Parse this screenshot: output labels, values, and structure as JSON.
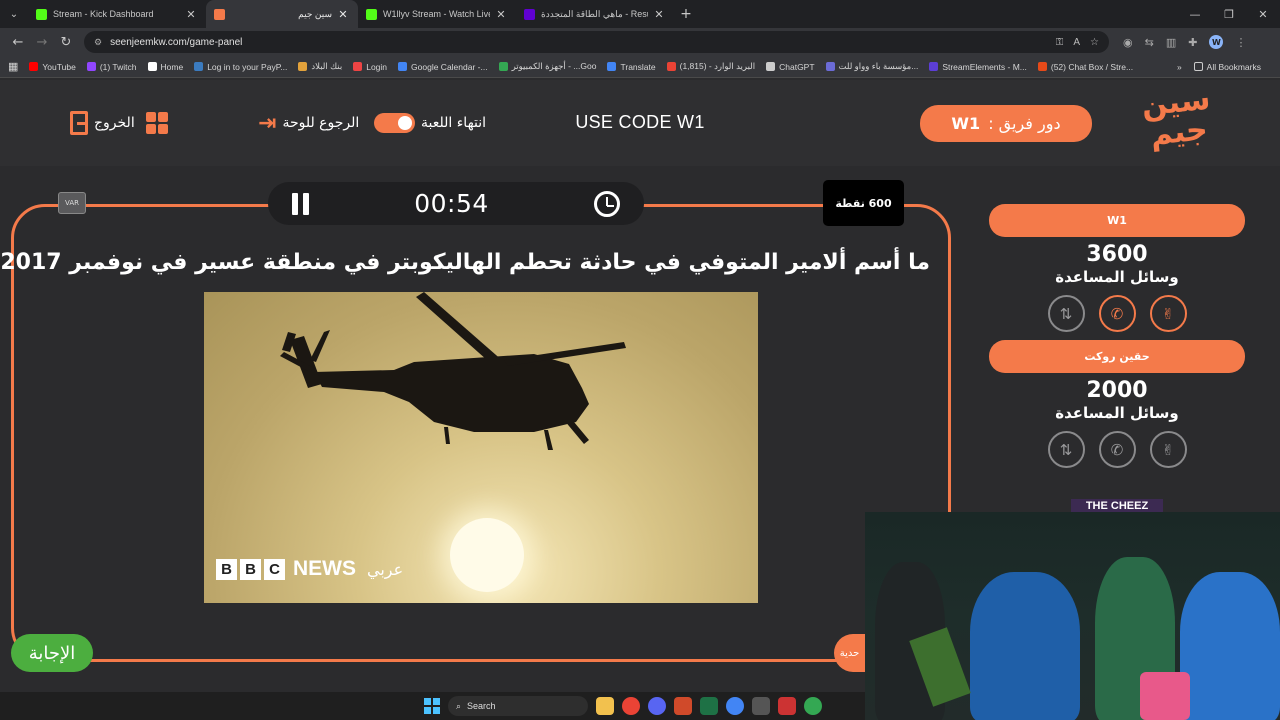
{
  "browser": {
    "tabs": [
      {
        "title": "Stream - Kick Dashboard",
        "color": "#53fc18",
        "active": false
      },
      {
        "title": "سين جيم",
        "color": "#f47a4a",
        "active": true
      },
      {
        "title": "W1llyv Stream - Watch Live on",
        "color": "#53fc18",
        "active": false
      },
      {
        "title": "ماهي الطاقة المتجددة - Results",
        "color": "#6001d2",
        "active": false
      }
    ],
    "url": "seenjeemkw.com/game-panel",
    "bookmarks": [
      {
        "label": "YouTube",
        "color": "#ff0000"
      },
      {
        "label": "(1) Twitch",
        "color": "#9146ff"
      },
      {
        "label": "Home",
        "color": "#ffffff"
      },
      {
        "label": "Log in to your PayP...",
        "color": "#3b7bbf"
      },
      {
        "label": "بنك البلاد",
        "color": "#e2a23b"
      },
      {
        "label": "Login",
        "color": "#e44"
      },
      {
        "label": "Google Calendar -...",
        "color": "#4285f4"
      },
      {
        "label": "أجهزة الكمبيوتر - ...Goo",
        "color": "#34a853"
      },
      {
        "label": "Translate",
        "color": "#4285f4"
      },
      {
        "label": "البريد الوارد - (1,815)",
        "color": "#ea4335"
      },
      {
        "label": "ChatGPT",
        "color": "#cccccc"
      },
      {
        "label": "مؤسسة باء وواو للت...",
        "color": "#6b6bd6"
      },
      {
        "label": "StreamElements - M...",
        "color": "#5c3ed6"
      },
      {
        "label": "(52) Chat Box / Stre...",
        "color": "#e64a19"
      }
    ],
    "all_bookmarks": "All Bookmarks"
  },
  "header": {
    "logo_text": "سين جيم",
    "turn_prefix": "دور فريق :",
    "turn_team": "W1",
    "promo": "USE CODE W1",
    "end_game": "انتهاء اللعبة",
    "back_to_board": "الرجوع للوحة",
    "exit": "الخروج"
  },
  "question_panel": {
    "var_label": "VAR",
    "timer": "00:54",
    "points": "600 نقطة",
    "question": "ما أسم ألامير المتوفي في حادثة تحطم الهاليكوبتر في منطقة عسير في نوفمبر 2017؟",
    "image_caption_bbc": [
      "B",
      "B",
      "C"
    ],
    "image_caption_news": "NEWS",
    "image_caption_arabic": "عربي",
    "answer_button": "الإجابة",
    "side_tab": "حدية"
  },
  "teams": [
    {
      "name": "W1",
      "score": "3600",
      "help_label": "وسائل المساعدة",
      "lifelines": [
        {
          "icon": "swap-icon",
          "active": false
        },
        {
          "icon": "phone-icon",
          "active": true
        },
        {
          "icon": "peace-hand-icon",
          "active": true
        }
      ]
    },
    {
      "name": "حقين روكت",
      "score": "2000",
      "help_label": "وسائل المساعدة",
      "lifelines": [
        {
          "icon": "swap-icon",
          "active": false
        },
        {
          "icon": "phone-icon",
          "active": false
        },
        {
          "icon": "peace-hand-icon",
          "active": false
        }
      ]
    }
  ],
  "overlay": {
    "banner": "THE CHEEZ"
  },
  "taskbar": {
    "search": "Search"
  },
  "colors": {
    "accent": "#f47a4a",
    "answer": "#4cae3f",
    "background": "#2b2b2d"
  }
}
